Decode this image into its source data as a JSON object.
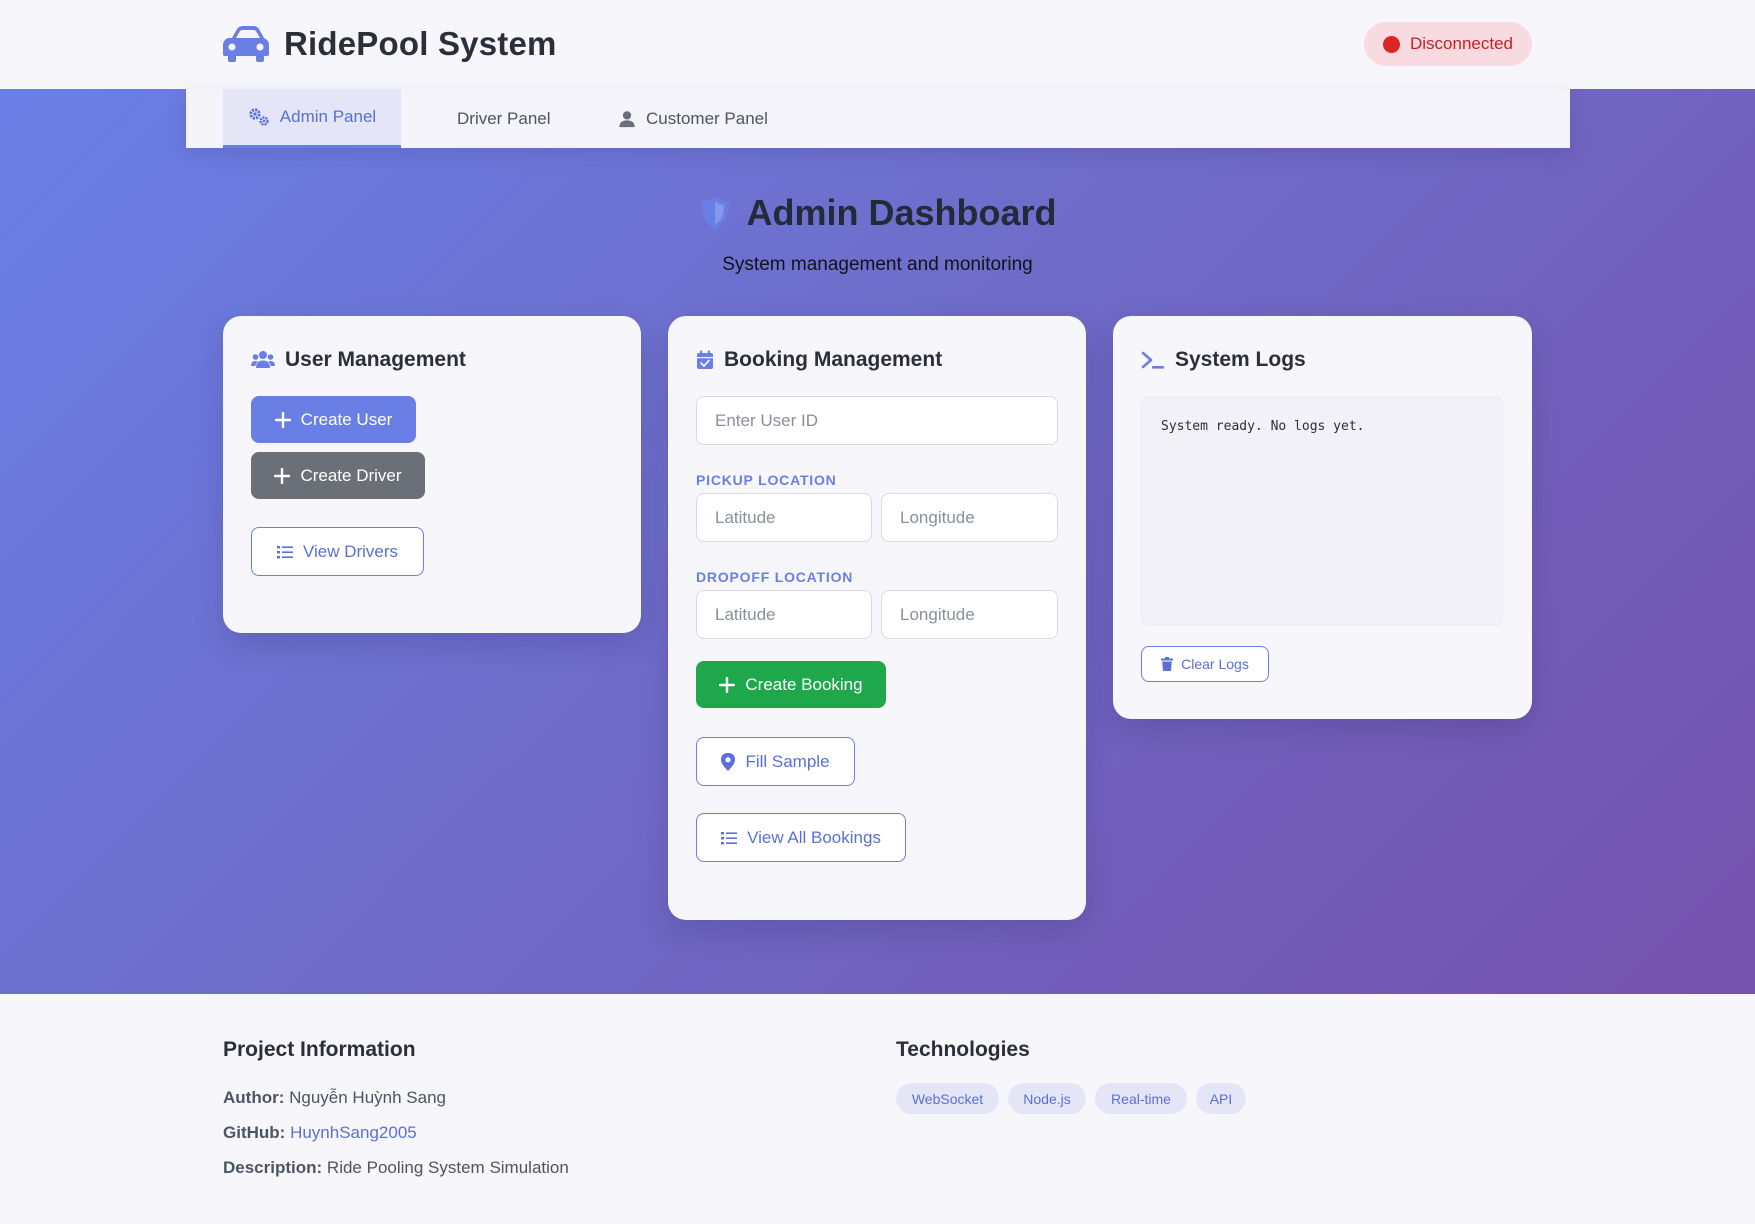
{
  "header": {
    "app_title": "RidePool System",
    "status_label": "Disconnected",
    "status_color": "#dc2626"
  },
  "tabs": [
    {
      "label": "Admin Panel",
      "icon": "gears-icon",
      "active": true
    },
    {
      "label": "Driver Panel",
      "icon": "car-icon",
      "active": false
    },
    {
      "label": "Customer Panel",
      "icon": "user-icon",
      "active": false
    }
  ],
  "page": {
    "title": "Admin Dashboard",
    "subtitle": "System management and monitoring"
  },
  "user_management": {
    "title": "User Management",
    "create_user_label": "Create User",
    "create_driver_label": "Create Driver",
    "view_drivers_label": "View Drivers"
  },
  "booking_management": {
    "title": "Booking Management",
    "user_id_placeholder": "Enter User ID",
    "pickup_label": "PICKUP LOCATION",
    "dropoff_label": "DROPOFF LOCATION",
    "latitude_placeholder": "Latitude",
    "longitude_placeholder": "Longitude",
    "create_booking_label": "Create Booking",
    "fill_sample_label": "Fill Sample",
    "view_all_bookings_label": "View All Bookings"
  },
  "system_logs": {
    "title": "System Logs",
    "log_text": "System ready. No logs yet.",
    "clear_label": "Clear Logs"
  },
  "footer": {
    "project_heading": "Project Information",
    "author_key": "Author:",
    "author_value": "Nguyễn Huỳnh Sang",
    "github_key": "GitHub:",
    "github_value": "HuynhSang2005",
    "description_key": "Description:",
    "description_value": "Ride Pooling System Simulation",
    "tech_heading": "Technologies",
    "technologies": [
      "WebSocket",
      "Node.js",
      "Real-time",
      "API"
    ]
  },
  "colors": {
    "accent": "#6a7fe6",
    "success": "#1fa84b",
    "secondary": "#6b7078",
    "gradient_start": "#6a7fe6",
    "gradient_end": "#7452ad"
  }
}
